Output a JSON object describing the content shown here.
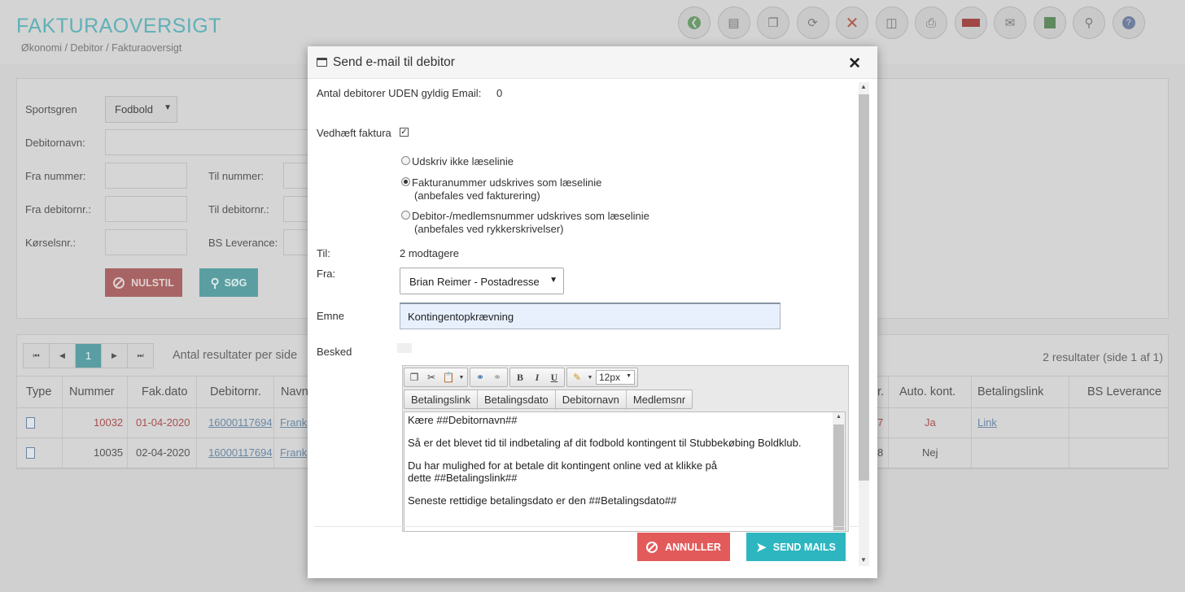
{
  "header": {
    "title": "FAKTURAOVERSIGT",
    "breadcrumb": "Økonomi / Debitor / Fakturaoversigt"
  },
  "toolbar": [
    "back-icon",
    "document-icon",
    "copy-icon",
    "refresh-icon",
    "delete-icon",
    "database-icon",
    "print-icon",
    "bs-icon",
    "mail-icon",
    "excel-icon",
    "search-icon",
    "help-icon"
  ],
  "filters": {
    "sportsgren_label": "Sportsgren",
    "sportsgren_value": "Fodbold",
    "debitornavn_label": "Debitornavn:",
    "fra_nummer_label": "Fra nummer:",
    "til_nummer_label": "Til nummer:",
    "fra_debitornr_label": "Fra debitornr.:",
    "til_debitornr_label": "Til debitornr.:",
    "korselsnr_label": "Kørselsnr.:",
    "bs_leverance_label": "BS Leverance:",
    "reset_label": "NULSTIL",
    "search_label": "SØG"
  },
  "results": {
    "page": "1",
    "per_side_label": "Antal resultater per side",
    "count": "2 resultater (side 1 af 1)",
    "columns": [
      "Type",
      "Nummer",
      "Fak.dato",
      "Debitornr.",
      "Navn",
      "r.",
      "Auto. kont.",
      "Betalingslink",
      "BS Leverance"
    ],
    "rows": [
      {
        "nummer": "10032",
        "dato": "01-04-2020",
        "debitornr": "16000117694",
        "navn": "Frank",
        "frag": "7",
        "auto": "Ja",
        "link": "Link"
      },
      {
        "nummer": "10035",
        "dato": "02-04-2020",
        "debitornr": "16000117694",
        "navn": "Frank",
        "frag": "8",
        "auto": "Nej",
        "link": ""
      }
    ]
  },
  "modal": {
    "title": "Send e-mail til debitor",
    "no_email_label": "Antal debitorer UDEN gyldig Email:",
    "no_email_count": "0",
    "attach_label": "Vedhæft faktura",
    "radio1": "Udskriv ikke læselinie",
    "radio2": "Fakturanummer udskrives som læselinie",
    "radio2_sub": "(anbefales ved fakturering)",
    "radio3": "Debitor-/medlemsnummer udskrives som læselinie",
    "radio3_sub": "(anbefales ved rykkerskrivelser)",
    "til_label": "Til:",
    "til_value": "2 modtagere",
    "fra_label": "Fra:",
    "fra_value": "Brian Reimer - Postadresse",
    "emne_label": "Emne",
    "emne_value": "Kontingentopkrævning",
    "besked_label": "Besked",
    "font_size": "12px",
    "merge_tags": [
      "Betalingslink",
      "Betalingsdato",
      "Debitornavn",
      "Medlemsnr"
    ],
    "body": {
      "l1": "Kære ##Debitornavn##",
      "l2": "Så er det blevet tid til indbetaling af dit fodbold kontingent til Stubbekøbing Boldklub.",
      "l3a": "Du har mulighed for at betale dit kontingent online ved at klikke på",
      "l3b": "dette ",
      "l3tag": "##Betalingslink##",
      "l4": "Seneste rettidige betalingsdato er den ",
      "l4tag": "##Betalingsdato##"
    },
    "cancel_label": "ANNULLER",
    "send_label": "SEND MAILS"
  },
  "colors": {
    "accent": "#2eb6c0",
    "danger": "#e35a5a",
    "title": "#5fb0b7"
  }
}
